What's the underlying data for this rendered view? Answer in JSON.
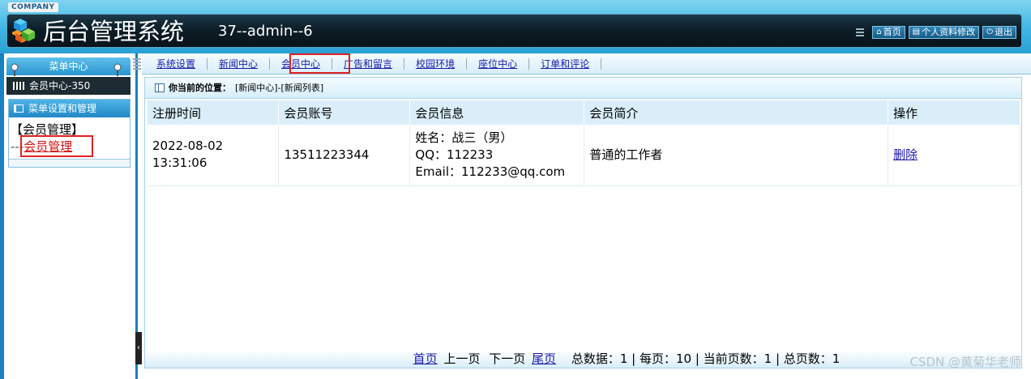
{
  "header": {
    "company": "COMPANY",
    "title": "后台管理系统",
    "user": "37--admin--6",
    "buttons": [
      {
        "label": "首页",
        "icon": "home-icon"
      },
      {
        "label": "个人资料修改",
        "icon": "document-icon"
      },
      {
        "label": "退出",
        "icon": "power-icon"
      }
    ]
  },
  "sidebar": {
    "menu_center": "菜单中心",
    "member_center": "会员中心-350",
    "section_title": "菜单设置和管理",
    "group_label": "【会员管理】",
    "link_prefix": "---",
    "link_label": "会员管理"
  },
  "nav": {
    "tabs": [
      "系统设置",
      "新闻中心",
      "会员中心",
      "广告和留言",
      "校园环境",
      "座位中心",
      "订单和评论"
    ],
    "active": "会员中心"
  },
  "breadcrumb": {
    "label": "你当前的位置：",
    "path": "[新闻中心]-[新闻列表]"
  },
  "table": {
    "headers": [
      "注册时间",
      "会员账号",
      "会员信息",
      "会员简介",
      "操作"
    ],
    "rows": [
      {
        "reg_date": "2022-08-02",
        "reg_time": "13:31:06",
        "account": "13511223344",
        "info_name": "姓名：战三（男）",
        "info_qq": "QQ：112233",
        "info_email": "Email：112233@qq.com",
        "intro": "普通的工作者",
        "action": "删除"
      }
    ]
  },
  "pager": {
    "first": "首页",
    "prev": "上一页",
    "next": "下一页",
    "last": "尾页",
    "summary": "总数据：1 | 每页：10 | 当前页数：1 | 总页数：1"
  },
  "watermark": "CSDN @黄菊华老师"
}
